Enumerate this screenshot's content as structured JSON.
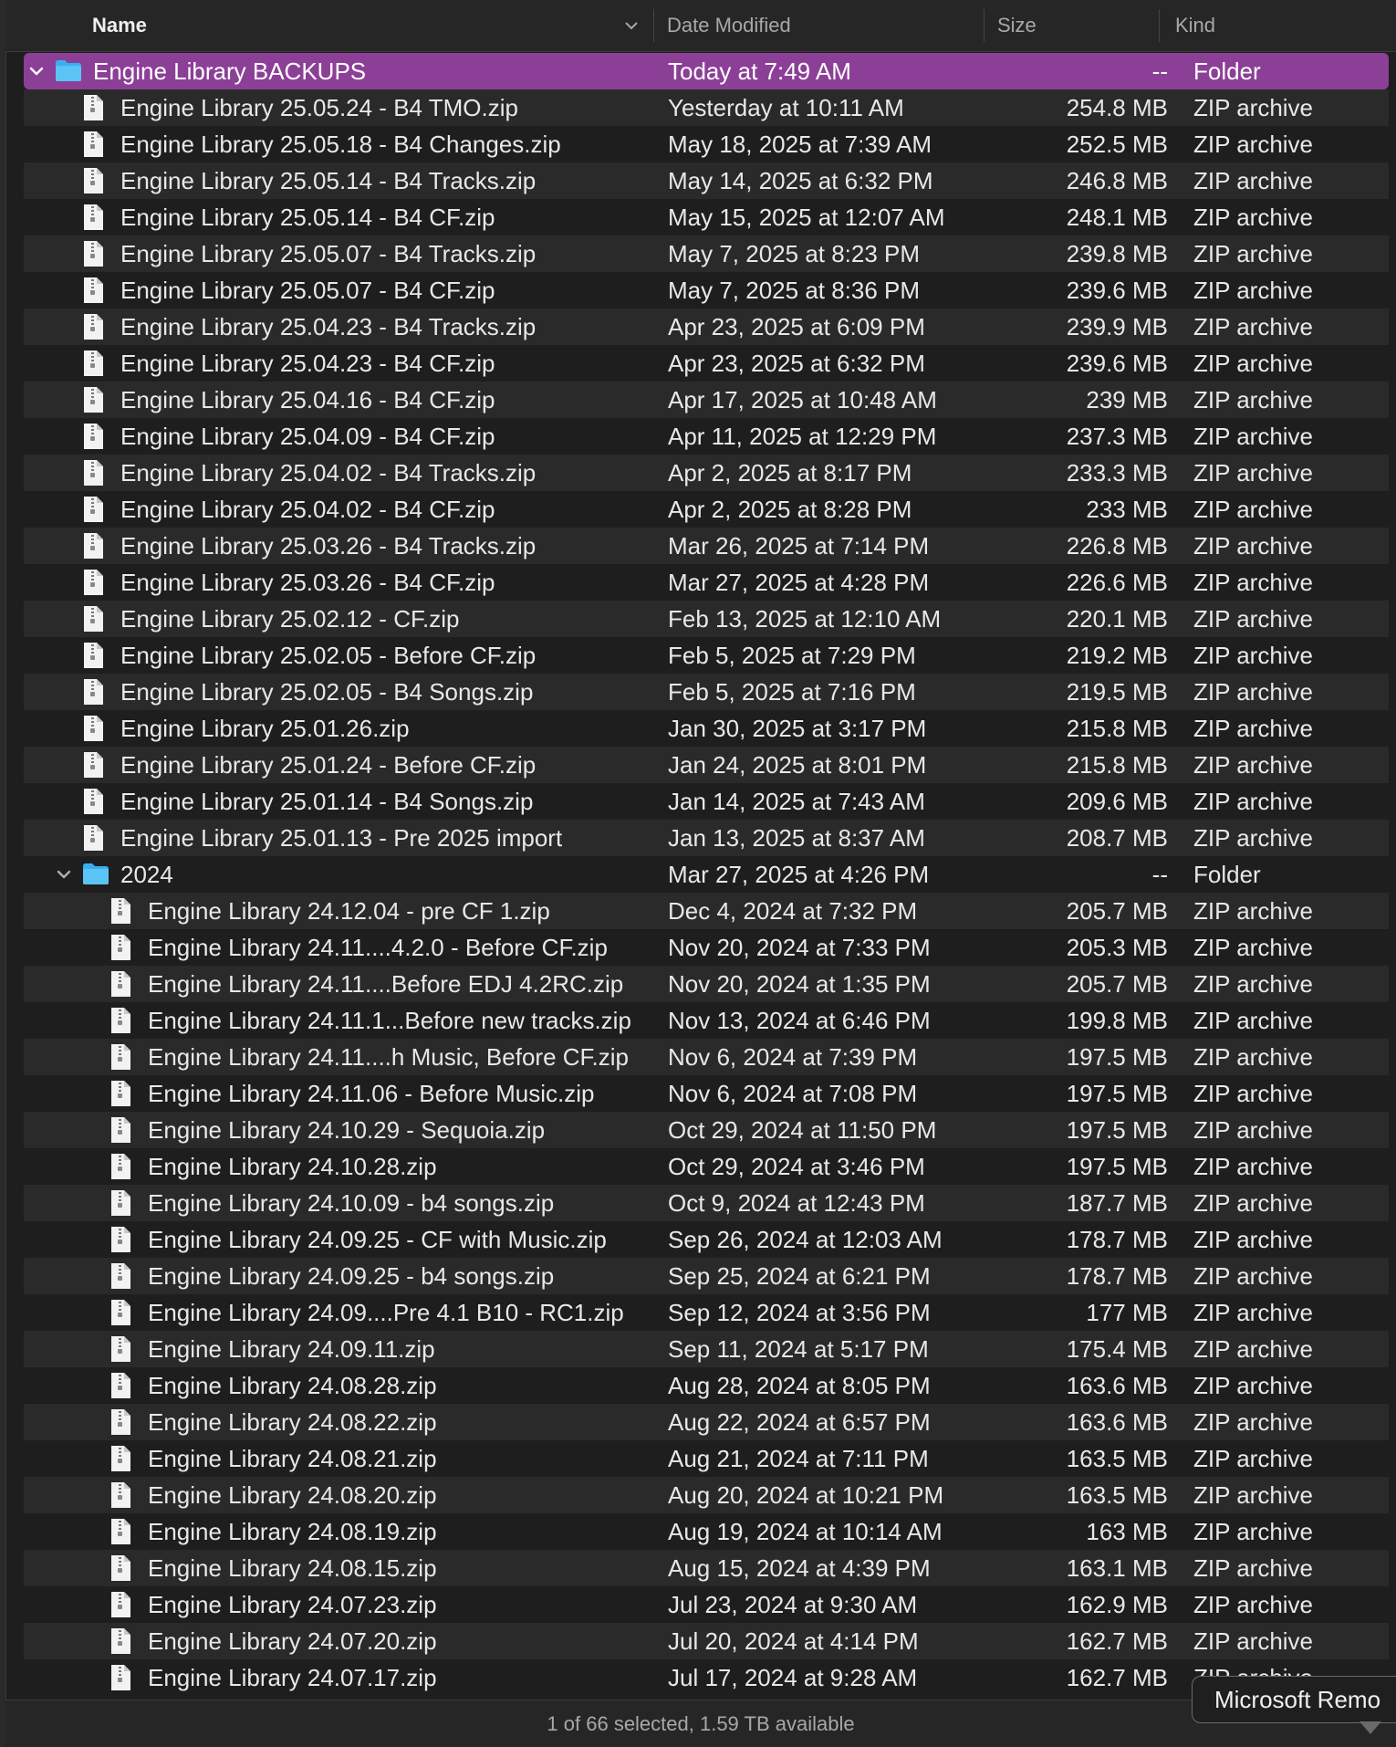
{
  "header": {
    "name_label": "Name",
    "date_label": "Date Modified",
    "size_label": "Size",
    "kind_label": "Kind"
  },
  "colors": {
    "selection": "#8c3f97",
    "folder": "#38b0f0",
    "background": "#1e1e1e",
    "alt_row": "#2a2a2a"
  },
  "rows": [
    {
      "type": "folder",
      "level": 0,
      "expanded": true,
      "selected": true,
      "name": "Engine Library BACKUPS",
      "date": "Today at 7:49 AM",
      "size": "--",
      "kind": "Folder"
    },
    {
      "type": "file",
      "level": 1,
      "name": "Engine Library 25.05.24 - B4 TMO.zip",
      "date": "Yesterday at 10:11 AM",
      "size": "254.8 MB",
      "kind": "ZIP archive"
    },
    {
      "type": "file",
      "level": 1,
      "name": "Engine Library 25.05.18 - B4 Changes.zip",
      "date": "May 18, 2025 at 7:39 AM",
      "size": "252.5 MB",
      "kind": "ZIP archive"
    },
    {
      "type": "file",
      "level": 1,
      "name": "Engine Library 25.05.14 - B4 Tracks.zip",
      "date": "May 14, 2025 at 6:32 PM",
      "size": "246.8 MB",
      "kind": "ZIP archive"
    },
    {
      "type": "file",
      "level": 1,
      "name": "Engine Library 25.05.14 - B4 CF.zip",
      "date": "May 15, 2025 at 12:07 AM",
      "size": "248.1 MB",
      "kind": "ZIP archive"
    },
    {
      "type": "file",
      "level": 1,
      "name": "Engine Library 25.05.07 - B4 Tracks.zip",
      "date": "May 7, 2025 at 8:23 PM",
      "size": "239.8 MB",
      "kind": "ZIP archive"
    },
    {
      "type": "file",
      "level": 1,
      "name": "Engine Library 25.05.07 - B4 CF.zip",
      "date": "May 7, 2025 at 8:36 PM",
      "size": "239.6 MB",
      "kind": "ZIP archive"
    },
    {
      "type": "file",
      "level": 1,
      "name": "Engine Library 25.04.23 - B4 Tracks.zip",
      "date": "Apr 23, 2025 at 6:09 PM",
      "size": "239.9 MB",
      "kind": "ZIP archive"
    },
    {
      "type": "file",
      "level": 1,
      "name": "Engine Library 25.04.23 - B4 CF.zip",
      "date": "Apr 23, 2025 at 6:32 PM",
      "size": "239.6 MB",
      "kind": "ZIP archive"
    },
    {
      "type": "file",
      "level": 1,
      "name": "Engine Library 25.04.16 - B4 CF.zip",
      "date": "Apr 17, 2025 at 10:48 AM",
      "size": "239 MB",
      "kind": "ZIP archive"
    },
    {
      "type": "file",
      "level": 1,
      "name": "Engine Library 25.04.09 - B4 CF.zip",
      "date": "Apr 11, 2025 at 12:29 PM",
      "size": "237.3 MB",
      "kind": "ZIP archive"
    },
    {
      "type": "file",
      "level": 1,
      "name": "Engine Library 25.04.02 - B4 Tracks.zip",
      "date": "Apr 2, 2025 at 8:17 PM",
      "size": "233.3 MB",
      "kind": "ZIP archive"
    },
    {
      "type": "file",
      "level": 1,
      "name": "Engine Library 25.04.02 - B4 CF.zip",
      "date": "Apr 2, 2025 at 8:28 PM",
      "size": "233 MB",
      "kind": "ZIP archive"
    },
    {
      "type": "file",
      "level": 1,
      "name": "Engine Library 25.03.26 - B4 Tracks.zip",
      "date": "Mar 26, 2025 at 7:14 PM",
      "size": "226.8 MB",
      "kind": "ZIP archive"
    },
    {
      "type": "file",
      "level": 1,
      "name": "Engine Library 25.03.26 - B4 CF.zip",
      "date": "Mar 27, 2025 at 4:28 PM",
      "size": "226.6 MB",
      "kind": "ZIP archive"
    },
    {
      "type": "file",
      "level": 1,
      "name": "Engine Library 25.02.12 - CF.zip",
      "date": "Feb 13, 2025 at 12:10 AM",
      "size": "220.1 MB",
      "kind": "ZIP archive"
    },
    {
      "type": "file",
      "level": 1,
      "name": "Engine Library 25.02.05 - Before CF.zip",
      "date": "Feb 5, 2025 at 7:29 PM",
      "size": "219.2 MB",
      "kind": "ZIP archive"
    },
    {
      "type": "file",
      "level": 1,
      "name": "Engine Library 25.02.05 - B4 Songs.zip",
      "date": "Feb 5, 2025 at 7:16 PM",
      "size": "219.5 MB",
      "kind": "ZIP archive"
    },
    {
      "type": "file",
      "level": 1,
      "name": "Engine Library 25.01.26.zip",
      "date": "Jan 30, 2025 at 3:17 PM",
      "size": "215.8 MB",
      "kind": "ZIP archive"
    },
    {
      "type": "file",
      "level": 1,
      "name": "Engine Library 25.01.24 - Before CF.zip",
      "date": "Jan 24, 2025 at 8:01 PM",
      "size": "215.8 MB",
      "kind": "ZIP archive"
    },
    {
      "type": "file",
      "level": 1,
      "name": "Engine Library 25.01.14 - B4 Songs.zip",
      "date": "Jan 14, 2025 at 7:43 AM",
      "size": "209.6 MB",
      "kind": "ZIP archive"
    },
    {
      "type": "file",
      "level": 1,
      "name": "Engine Library 25.01.13 - Pre 2025 import",
      "date": "Jan 13, 2025 at 8:37 AM",
      "size": "208.7 MB",
      "kind": "ZIP archive"
    },
    {
      "type": "folder",
      "level": 1,
      "expanded": true,
      "name": "2024",
      "date": "Mar 27, 2025 at 4:26 PM",
      "size": "--",
      "kind": "Folder"
    },
    {
      "type": "file",
      "level": 2,
      "name": "Engine Library 24.12.04 - pre CF 1.zip",
      "date": "Dec 4, 2024 at 7:32 PM",
      "size": "205.7 MB",
      "kind": "ZIP archive"
    },
    {
      "type": "file",
      "level": 2,
      "name": "Engine Library 24.11....4.2.0 -  Before CF.zip",
      "date": "Nov 20, 2024 at 7:33 PM",
      "size": "205.3 MB",
      "kind": "ZIP archive"
    },
    {
      "type": "file",
      "level": 2,
      "name": "Engine Library 24.11....Before EDJ 4.2RC.zip",
      "date": "Nov 20, 2024 at 1:35 PM",
      "size": "205.7 MB",
      "kind": "ZIP archive"
    },
    {
      "type": "file",
      "level": 2,
      "name": "Engine Library 24.11.1...Before new tracks.zip",
      "date": "Nov 13, 2024 at 6:46 PM",
      "size": "199.8 MB",
      "kind": "ZIP archive"
    },
    {
      "type": "file",
      "level": 2,
      "name": "Engine Library 24.11....h Music, Before CF.zip",
      "date": "Nov 6, 2024 at 7:39 PM",
      "size": "197.5 MB",
      "kind": "ZIP archive"
    },
    {
      "type": "file",
      "level": 2,
      "name": "Engine Library 24.11.06 - Before Music.zip",
      "date": "Nov 6, 2024 at 7:08 PM",
      "size": "197.5 MB",
      "kind": "ZIP archive"
    },
    {
      "type": "file",
      "level": 2,
      "name": "Engine Library 24.10.29 - Sequoia.zip",
      "date": "Oct 29, 2024 at 11:50 PM",
      "size": "197.5 MB",
      "kind": "ZIP archive"
    },
    {
      "type": "file",
      "level": 2,
      "name": "Engine Library 24.10.28.zip",
      "date": "Oct 29, 2024 at 3:46 PM",
      "size": "197.5 MB",
      "kind": "ZIP archive"
    },
    {
      "type": "file",
      "level": 2,
      "name": "Engine Library 24.10.09 - b4 songs.zip",
      "date": "Oct 9, 2024 at 12:43 PM",
      "size": "187.7 MB",
      "kind": "ZIP archive"
    },
    {
      "type": "file",
      "level": 2,
      "name": "Engine Library 24.09.25 - CF with Music.zip",
      "date": "Sep 26, 2024 at 12:03 AM",
      "size": "178.7 MB",
      "kind": "ZIP archive"
    },
    {
      "type": "file",
      "level": 2,
      "name": "Engine Library 24.09.25 - b4 songs.zip",
      "date": "Sep 25, 2024 at 6:21 PM",
      "size": "178.7 MB",
      "kind": "ZIP archive"
    },
    {
      "type": "file",
      "level": 2,
      "name": "Engine Library 24.09....Pre 4.1 B10 - RC1.zip",
      "date": "Sep 12, 2024 at 3:56 PM",
      "size": "177 MB",
      "kind": "ZIP archive"
    },
    {
      "type": "file",
      "level": 2,
      "name": "Engine Library 24.09.11.zip",
      "date": "Sep 11, 2024 at 5:17 PM",
      "size": "175.4 MB",
      "kind": "ZIP archive"
    },
    {
      "type": "file",
      "level": 2,
      "name": "Engine Library 24.08.28.zip",
      "date": "Aug 28, 2024 at 8:05 PM",
      "size": "163.6 MB",
      "kind": "ZIP archive"
    },
    {
      "type": "file",
      "level": 2,
      "name": "Engine Library 24.08.22.zip",
      "date": "Aug 22, 2024 at 6:57 PM",
      "size": "163.6 MB",
      "kind": "ZIP archive"
    },
    {
      "type": "file",
      "level": 2,
      "name": "Engine Library 24.08.21.zip",
      "date": "Aug 21, 2024 at 7:11 PM",
      "size": "163.5 MB",
      "kind": "ZIP archive"
    },
    {
      "type": "file",
      "level": 2,
      "name": "Engine Library 24.08.20.zip",
      "date": "Aug 20, 2024 at 10:21 PM",
      "size": "163.5 MB",
      "kind": "ZIP archive"
    },
    {
      "type": "file",
      "level": 2,
      "name": "Engine Library 24.08.19.zip",
      "date": "Aug 19, 2024 at 10:14 AM",
      "size": "163 MB",
      "kind": "ZIP archive"
    },
    {
      "type": "file",
      "level": 2,
      "name": "Engine Library 24.08.15.zip",
      "date": "Aug 15, 2024 at 4:39 PM",
      "size": "163.1 MB",
      "kind": "ZIP archive"
    },
    {
      "type": "file",
      "level": 2,
      "name": "Engine Library 24.07.23.zip",
      "date": "Jul 23, 2024 at 9:30 AM",
      "size": "162.9 MB",
      "kind": "ZIP archive"
    },
    {
      "type": "file",
      "level": 2,
      "name": "Engine Library 24.07.20.zip",
      "date": "Jul 20, 2024 at 4:14 PM",
      "size": "162.7 MB",
      "kind": "ZIP archive"
    },
    {
      "type": "file",
      "level": 2,
      "name": "Engine Library 24.07.17.zip",
      "date": "Jul 17, 2024 at 9:28 AM",
      "size": "162.7 MB",
      "kind": "ZIP archive"
    }
  ],
  "status": {
    "text": "1 of 66 selected, 1.59 TB available"
  },
  "tooltip": {
    "text": "Microsoft Remo"
  }
}
